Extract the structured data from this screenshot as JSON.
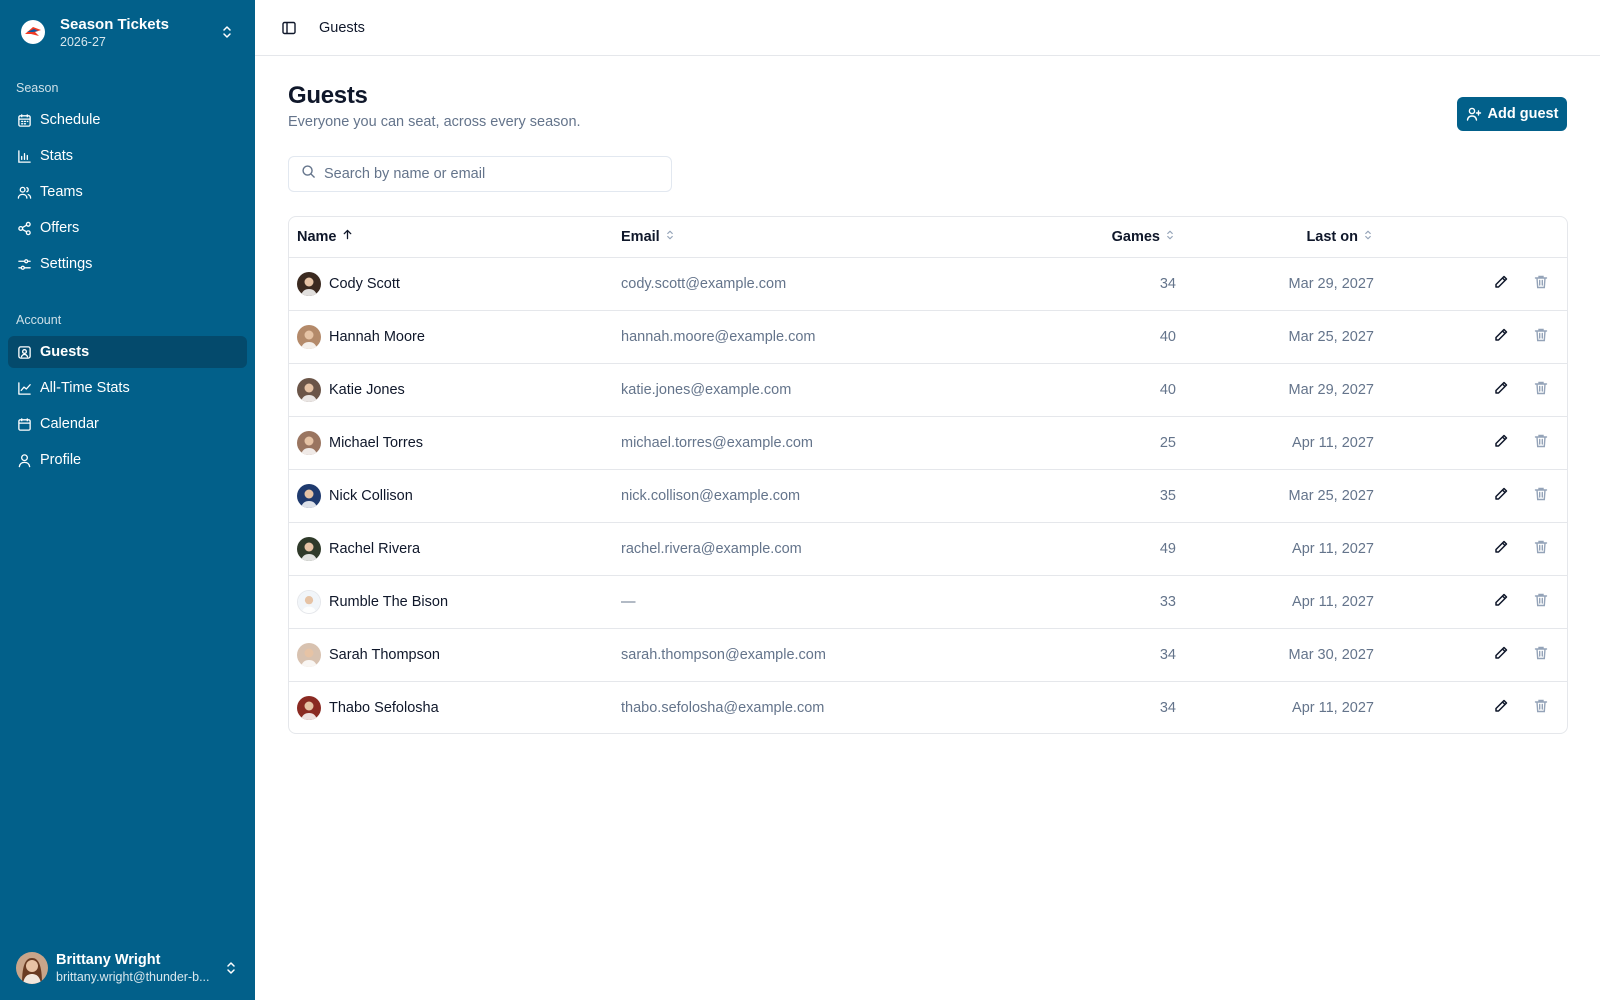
{
  "app": {
    "title": "Season Tickets",
    "subtitle": "2026-27",
    "logo_icon": "team-logo-icon",
    "switch_icon": "chevrons-up-down-icon"
  },
  "colors": {
    "sidebar": "#02608a",
    "sidebar_active": "#044a6c",
    "accent": "#02608a",
    "muted_text": "#64748b",
    "border": "#e5e7eb"
  },
  "sidebar": {
    "season_label": "Season",
    "season_items": [
      {
        "label": "Schedule",
        "icon": "calendar-icon"
      },
      {
        "label": "Stats",
        "icon": "bar-chart-icon"
      },
      {
        "label": "Teams",
        "icon": "users-icon"
      },
      {
        "label": "Offers",
        "icon": "share-icon"
      },
      {
        "label": "Settings",
        "icon": "sliders-icon"
      }
    ],
    "account_label": "Account",
    "account_items": [
      {
        "label": "Guests",
        "icon": "contact-icon",
        "active": true
      },
      {
        "label": "All-Time Stats",
        "icon": "line-chart-icon"
      },
      {
        "label": "Calendar",
        "icon": "calendar-icon"
      },
      {
        "label": "Profile",
        "icon": "user-icon"
      }
    ]
  },
  "user": {
    "name": "Brittany Wright",
    "email": "brittany.wright@thunder-b..."
  },
  "header": {
    "toggle_icon": "panel-left-icon",
    "breadcrumb": "Guests"
  },
  "main": {
    "title": "Guests",
    "subtitle": "Everyone you can seat, across every season.",
    "add_button": "Add guest",
    "add_icon": "user-plus-icon",
    "search_placeholder": "Search by name or email",
    "search_value": "",
    "search_icon": "search-icon"
  },
  "table": {
    "columns": {
      "name": "Name",
      "email": "Email",
      "games": "Games",
      "last_on": "Last on"
    },
    "sort": {
      "column": "name",
      "direction": "asc"
    },
    "rows": [
      {
        "name": "Cody Scott",
        "email": "cody.scott@example.com",
        "games": "34",
        "last_on": "Mar 29, 2027",
        "avatar_color": "#3b2a20"
      },
      {
        "name": "Hannah Moore",
        "email": "hannah.moore@example.com",
        "games": "40",
        "last_on": "Mar 25, 2027",
        "avatar_color": "#b48a6a"
      },
      {
        "name": "Katie Jones",
        "email": "katie.jones@example.com",
        "games": "40",
        "last_on": "Mar 29, 2027",
        "avatar_color": "#6b5548"
      },
      {
        "name": "Michael Torres",
        "email": "michael.torres@example.com",
        "games": "25",
        "last_on": "Apr 11, 2027",
        "avatar_color": "#9a7560"
      },
      {
        "name": "Nick Collison",
        "email": "nick.collison@example.com",
        "games": "35",
        "last_on": "Mar 25, 2027",
        "avatar_color": "#1f3a6e"
      },
      {
        "name": "Rachel Rivera",
        "email": "rachel.rivera@example.com",
        "games": "49",
        "last_on": "Apr 11, 2027",
        "avatar_color": "#2f3a2a"
      },
      {
        "name": "Rumble The Bison",
        "email": "—",
        "games": "33",
        "last_on": "Apr 11, 2027",
        "avatar_color": "#f1f5f9"
      },
      {
        "name": "Sarah Thompson",
        "email": "sarah.thompson@example.com",
        "games": "34",
        "last_on": "Mar 30, 2027",
        "avatar_color": "#d8c2b0"
      },
      {
        "name": "Thabo Sefolosha",
        "email": "thabo.sefolosha@example.com",
        "games": "34",
        "last_on": "Apr 11, 2027",
        "avatar_color": "#8a2a22"
      }
    ]
  }
}
